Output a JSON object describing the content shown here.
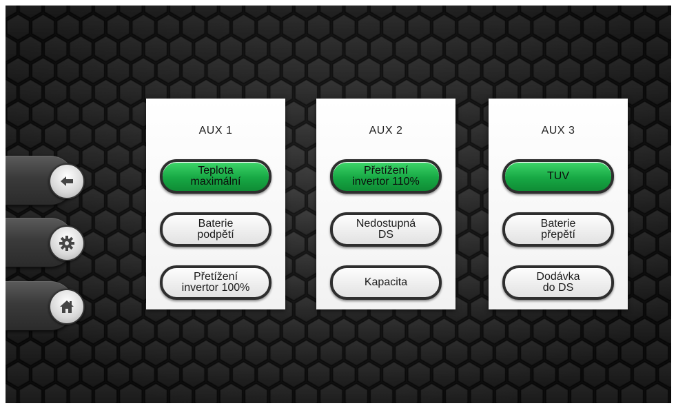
{
  "nav": {
    "buttons": [
      {
        "icon": "arrow-left-icon"
      },
      {
        "icon": "gear-icon"
      },
      {
        "icon": "home-icon"
      }
    ]
  },
  "colors": {
    "background": "#1c1c1c",
    "active_green": "#17a844",
    "panel": "#f5f5f5",
    "pill_border": "#2e2e2e"
  },
  "panels": [
    {
      "title": "AUX 1",
      "buttons": [
        {
          "label": "Teplota\nmaximální",
          "active": true
        },
        {
          "label": "Baterie\npodpětí",
          "active": false
        },
        {
          "label": "Přetížení\ninvertor 100%",
          "active": false
        }
      ]
    },
    {
      "title": "AUX 2",
      "buttons": [
        {
          "label": "Přetížení\ninvertor 110%",
          "active": true
        },
        {
          "label": "Nedostupná\nDS",
          "active": false
        },
        {
          "label": "Kapacita",
          "active": false
        }
      ]
    },
    {
      "title": "AUX 3",
      "buttons": [
        {
          "label": "TUV",
          "active": true
        },
        {
          "label": "Baterie\npřepětí",
          "active": false
        },
        {
          "label": "Dodávka\ndo DS",
          "active": false
        }
      ]
    }
  ]
}
